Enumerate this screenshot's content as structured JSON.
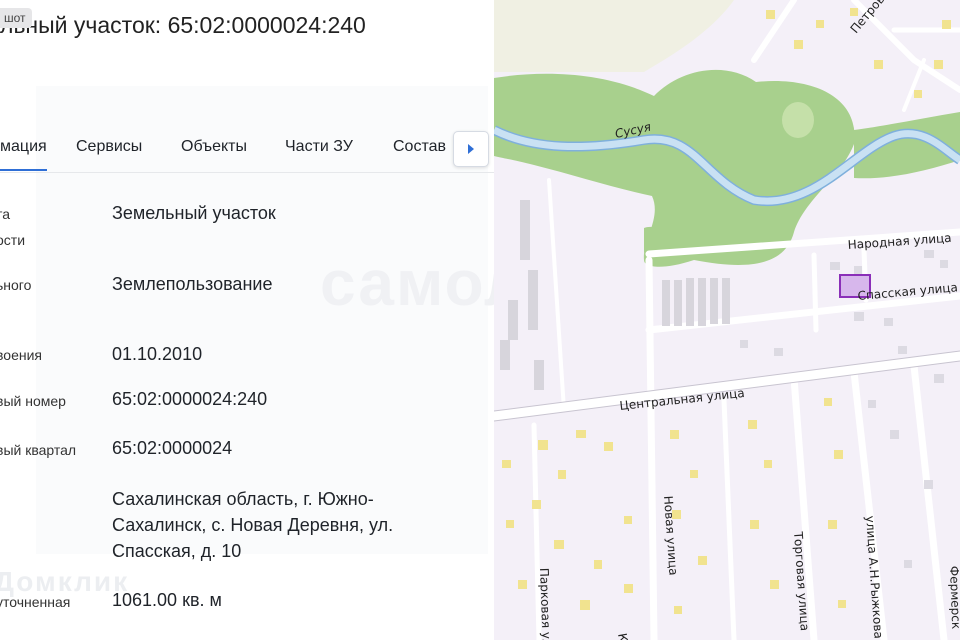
{
  "screenshot_badge": "шот",
  "title": "ельный участок: 65:02:0000024:240",
  "tabs": {
    "items": [
      "мация",
      "Сервисы",
      "Объекты",
      "Части ЗУ",
      "Состав"
    ],
    "active_index": 0
  },
  "rows": [
    {
      "label_lines": [
        "та",
        "ости"
      ],
      "value": "Земельный участок"
    },
    {
      "label_lines": [
        "ьного"
      ],
      "value": "Землепользование"
    },
    {
      "label_lines": [
        "воения"
      ],
      "value": "01.10.2010"
    },
    {
      "label_lines": [
        "вый номер"
      ],
      "value": "65:02:0000024:240"
    },
    {
      "label_lines": [
        "вый квартал"
      ],
      "value": "65:02:0000024"
    },
    {
      "label_lines": [],
      "value": "Сахалинская область, г. Южно-Сахалинск, с. Новая Деревня, ул. Спасская, д. 10"
    },
    {
      "label_lines": [
        "уточненная"
      ],
      "value": "1061.00 кв. м"
    }
  ],
  "watermarks": [
    "самолет",
    "Домклик"
  ],
  "map": {
    "labels": {
      "river": "Сусуя",
      "street_narodnaya": "Народная улица",
      "street_spasskaya": "Спасская улица",
      "street_tsentralnaya": "Центральная улица",
      "street_novaya": "Новая улица",
      "street_torgovaya": "Торговая улица",
      "street_ryzhkova": "улица А.Н.Рыжкова",
      "street_parkovaya": "Парковая улица",
      "street_fermerskaya": "Фермерск",
      "street_petrov": "Петров",
      "street_k": "К"
    },
    "colors": {
      "background": "#f4f0f8",
      "forest": "#a8d08d",
      "river": "#b9d8f0",
      "parcel_fill": "#d7b7ec",
      "parcel_stroke": "#8a2fb8",
      "building": "#d7d5dc",
      "small_building": "#f1e38f",
      "road": "#ffffff"
    }
  }
}
